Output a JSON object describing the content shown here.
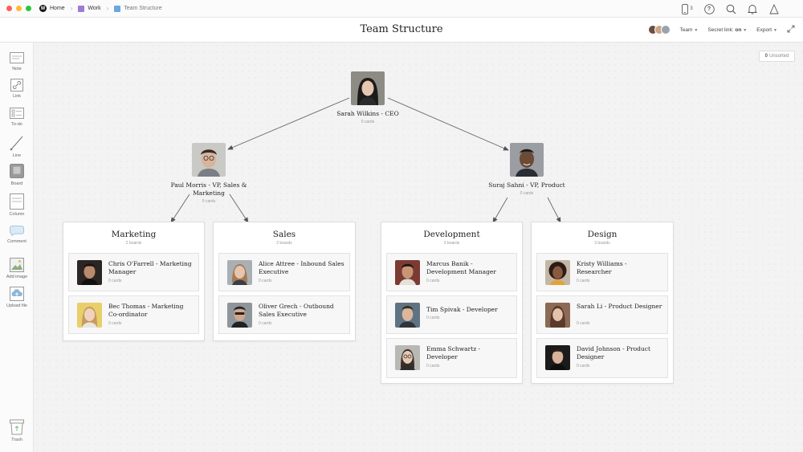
{
  "window": {
    "dots": [
      "#ff5f57",
      "#febc2e",
      "#28c840"
    ]
  },
  "breadcrumb": {
    "home": "Home",
    "work": "Work",
    "current": "Team Structure",
    "work_color": "#9d7bd8",
    "current_color": "#6aa6e0"
  },
  "top_icons": {
    "device_count": "3",
    "help": "?"
  },
  "header": {
    "title": "Team Structure",
    "team_label": "Team",
    "secret_link_label": "Secret link:",
    "secret_link_value": "on",
    "export_label": "Export"
  },
  "sidebar": {
    "tools": [
      {
        "label": "Note",
        "icon": "note-icon"
      },
      {
        "label": "Link",
        "icon": "link-icon"
      },
      {
        "label": "To-do",
        "icon": "todo-icon"
      },
      {
        "label": "Line",
        "icon": "line-icon"
      },
      {
        "label": "Board",
        "icon": "board-icon"
      },
      {
        "label": "Column",
        "icon": "column-icon"
      },
      {
        "label": "Comment",
        "icon": "comment-icon"
      },
      {
        "label": "Add image",
        "icon": "image-icon"
      },
      {
        "label": "Upload file",
        "icon": "upload-icon"
      }
    ],
    "trash_label": "Trash"
  },
  "canvas": {
    "unsorted_count": "0",
    "unsorted_label": "Unsorted"
  },
  "people": {
    "ceo": {
      "name": "Sarah Wilkins - CEO",
      "cards": "0 cards"
    },
    "vp_sales": {
      "name": "Paul Morris - VP, Sales & Marketing",
      "cards": "0 cards"
    },
    "vp_product": {
      "name": "Suraj Sahni - VP, Product",
      "cards": "0 cards"
    }
  },
  "boards": {
    "marketing": {
      "title": "Marketing",
      "count": "2 boards",
      "cards": [
        {
          "name": "Chris O'Farrell - Marketing Manager",
          "sub": "0 cards"
        },
        {
          "name": "Bec Thomas - Marketing Co-ordinator",
          "sub": "0 cards"
        }
      ]
    },
    "sales": {
      "title": "Sales",
      "count": "2 boards",
      "cards": [
        {
          "name": "Alice Attree - Inbound Sales Executive",
          "sub": "0 cards"
        },
        {
          "name": "Oliver Grech - Outbound Sales Executive",
          "sub": "0 cards"
        }
      ]
    },
    "development": {
      "title": "Development",
      "count": "3 boards",
      "cards": [
        {
          "name": "Marcus Banik - Development Manager",
          "sub": "0 cards"
        },
        {
          "name": "Tim Spivak - Developer",
          "sub": "0 cards"
        },
        {
          "name": "Emma Schwartz - Developer",
          "sub": "0 cards"
        }
      ]
    },
    "design": {
      "title": "Design",
      "count": "3 boards",
      "cards": [
        {
          "name": "Kristy Williams - Researcher",
          "sub": "0 cards"
        },
        {
          "name": "Sarah Li - Product Designer",
          "sub": "0 cards"
        },
        {
          "name": "David Johnson - Product Designer",
          "sub": "0 cards"
        }
      ]
    }
  }
}
